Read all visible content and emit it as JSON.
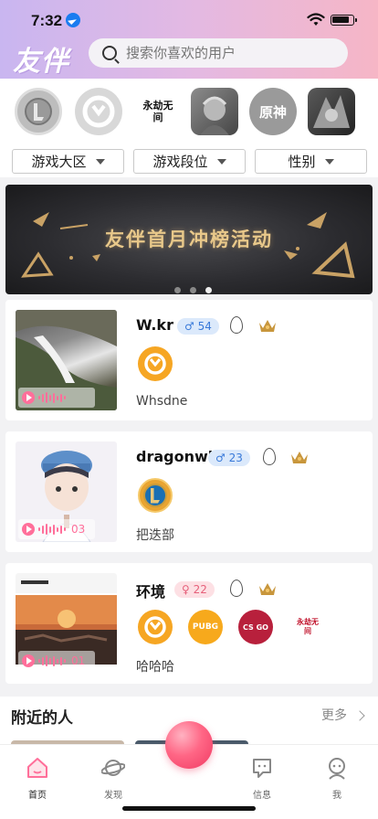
{
  "status_bar": {
    "time": "7:32"
  },
  "header": {
    "logo": "友伴",
    "search_placeholder": "搜索你喜欢的用户"
  },
  "games": [
    {
      "icon": "league-of-legends-icon",
      "label": "L"
    },
    {
      "icon": "overwatch-icon",
      "label": ""
    },
    {
      "icon": "naraka-icon",
      "label": "永劫无间"
    },
    {
      "icon": "hearthstone-icon",
      "label": ""
    },
    {
      "icon": "genshin-icon",
      "label": "原神"
    },
    {
      "icon": "dota-icon",
      "label": ""
    }
  ],
  "filters": [
    {
      "label": "游戏大区"
    },
    {
      "label": "游戏段位"
    },
    {
      "label": "性别"
    }
  ],
  "banner": {
    "title": "友伴首月冲榜活动",
    "dots": 3,
    "active_dot": 3
  },
  "cards": [
    {
      "username": "W.kr",
      "gender": "male",
      "gender_symbol": "♂",
      "age": "54",
      "voice_seconds": "",
      "games": [
        "overwatch-icon"
      ],
      "bio": "Whsdne"
    },
    {
      "username": "dragonwl",
      "gender": "male",
      "gender_symbol": "♂",
      "age": "23",
      "voice_seconds": "03",
      "games": [
        "league-of-legends-icon"
      ],
      "bio": "把迭部"
    },
    {
      "username": "环境",
      "gender": "female",
      "gender_symbol": "♀",
      "age": "22",
      "voice_seconds": "01",
      "games": [
        "overwatch-icon",
        "pubg-icon",
        "csgo-icon",
        "naraka-icon"
      ],
      "game_labels": [
        "",
        "PUBG",
        "CS GO",
        "永劫无间"
      ],
      "bio": "哈哈哈"
    }
  ],
  "nearby": {
    "title": "附近的人",
    "more": "更多"
  },
  "tabbar": [
    {
      "label": "首页",
      "icon": "home-icon",
      "active": true
    },
    {
      "label": "发现",
      "icon": "planet-icon",
      "active": false
    },
    {
      "label": "信息",
      "icon": "message-icon",
      "active": false
    },
    {
      "label": "我",
      "icon": "profile-icon",
      "active": false
    }
  ],
  "colors": {
    "accent_pink": "#ff6f9a",
    "male_blue": "#3a7ad9",
    "female_red": "#e6607a"
  }
}
